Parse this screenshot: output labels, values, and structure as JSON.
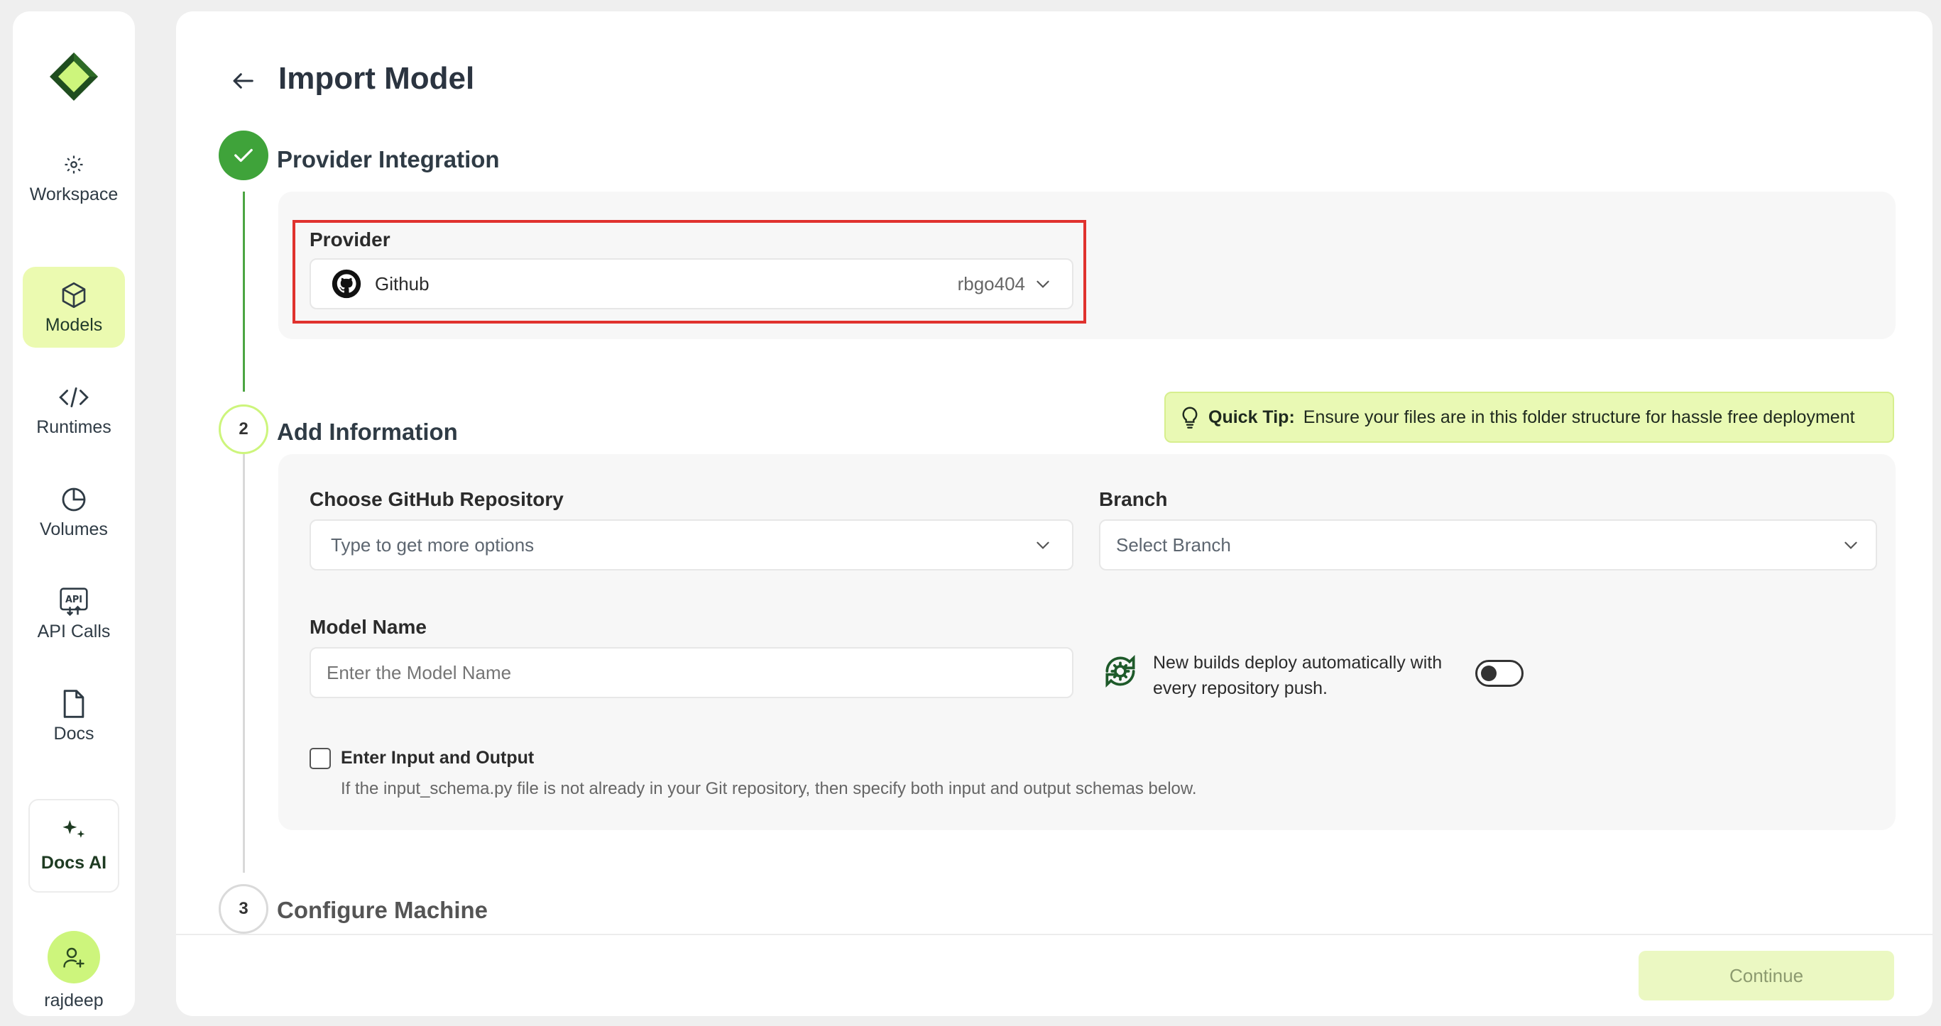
{
  "sidebar": {
    "workspace": "Workspace",
    "items": [
      {
        "label": "Models",
        "icon": "cube-icon",
        "active": true
      },
      {
        "label": "Runtimes",
        "icon": "code-icon",
        "active": false
      },
      {
        "label": "Volumes",
        "icon": "pie-chart-icon",
        "active": false
      },
      {
        "label": "API Calls",
        "icon": "api-icon",
        "active": false
      },
      {
        "label": "Docs",
        "icon": "document-icon",
        "active": false
      }
    ],
    "docs_ai": "Docs AI",
    "user": "rajdeep"
  },
  "header": {
    "title": "Import Model"
  },
  "steps": [
    {
      "number": "",
      "title": "Provider Integration",
      "status": "complete"
    },
    {
      "number": "2",
      "title": "Add Information",
      "status": "active"
    },
    {
      "number": "3",
      "title": "Configure Machine",
      "status": "pending"
    }
  ],
  "provider": {
    "label": "Provider",
    "value": "Github",
    "account": "rbgo404"
  },
  "quick_tip": {
    "bold": "Quick Tip:",
    "text": "Ensure your files are in this folder structure for hassle free deployment"
  },
  "repository": {
    "label": "Choose GitHub Repository",
    "placeholder": "Type to get more options"
  },
  "branch": {
    "label": "Branch",
    "placeholder": "Select Branch"
  },
  "model_name": {
    "label": "Model Name",
    "placeholder": "Enter the Model Name"
  },
  "auto_deploy": {
    "line1": "New builds deploy automatically with",
    "line2": "every repository push.",
    "enabled": false
  },
  "io_schema": {
    "label": "Enter Input and Output",
    "help": "If the input_schema.py file is not already in your Git repository, then specify both input and output schemas below.",
    "checked": false
  },
  "footer": {
    "continue_label": "Continue"
  },
  "colors": {
    "brand": "#cdf57c",
    "step_complete": "#3fa33a",
    "highlight": "#e0322e",
    "tip_bg": "#e9f9b4"
  }
}
